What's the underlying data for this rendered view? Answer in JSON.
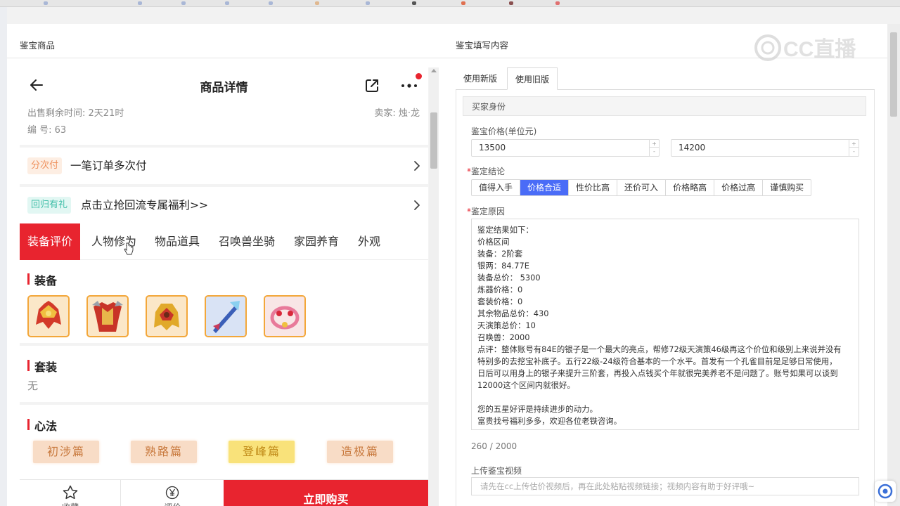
{
  "left_panel": {
    "title": "鉴宝商品",
    "phone": {
      "header_title": "商品详情",
      "sale_remaining": "出售剩余时间: 2天21时",
      "seller": "卖家: 烛·龙",
      "serial": "编 号: 63",
      "installment": {
        "tag": "分次付",
        "text": "一笔订单多次付"
      },
      "return_benefit": {
        "tag": "回归有礼",
        "text": "点击立抢回流专属福利>>"
      },
      "tabs": [
        "装备评价",
        "人物修为",
        "物品道具",
        "召唤兽坐骑",
        "家园养育",
        "外观"
      ],
      "sections": {
        "equipment": "装备",
        "suit": "套装",
        "suit_value": "无",
        "xinfa": "心法"
      },
      "xinfa_items": [
        "初涉篇",
        "熟路篇",
        "登峰篇",
        "造极篇"
      ],
      "bottom": {
        "favorite": "收藏",
        "evaluate": "评价",
        "buy": "立即购买"
      }
    }
  },
  "right_panel": {
    "title": "鉴宝填写内容",
    "watermark": "CC直播",
    "version_tabs": [
      "使用新版",
      "使用旧版"
    ],
    "section_header": "买家身份",
    "price_label": "鉴宝价格(单位元)",
    "price_min": "13500",
    "price_max": "14200",
    "conclusion_label": "鉴定结论",
    "conclusions": [
      "值得入手",
      "价格合适",
      "性价比高",
      "还价可入",
      "价格略高",
      "价格过高",
      "谨慎购买"
    ],
    "reason_label": "鉴定原因",
    "reason_lines": [
      "鉴定结果如下：",
      "价格区间",
      "装备：2阶套",
      "银两：84.77E",
      "装备总价： 5300",
      "炼器价格：0",
      "套装价格：0",
      "其余物品总价：430",
      "天演策总价：10",
      "召唤兽：2000",
      "点评：整体账号有84E的银子是一个最大的亮点，帮修72级天演策46级再这个价位和级别上来说并没有",
      "特别多的去挖宝补底子。五行22级-24级符合基本的一个水平。首发有一个孔雀目前是足够日常使用，",
      "日后可以用身上的银子来提升三阶套，再投入点钱买个年就很完美养老不是问题了。账号如果可以谈到",
      "12000这个区间内就很好。",
      "",
      " 您的五星好评是持续进步的动力。",
      "富贵找号福利多多，欢迎各位老铁咨询。"
    ],
    "counter": "260 / 2000",
    "video_label": "上传鉴宝视频",
    "video_placeholder": "请先在cc上传估价视频后，再在此处粘贴视频链接；视频内容有助于好评哦~"
  },
  "colors": {
    "accent_red": "#e8242f",
    "accent_blue": "#4a6cf7"
  }
}
